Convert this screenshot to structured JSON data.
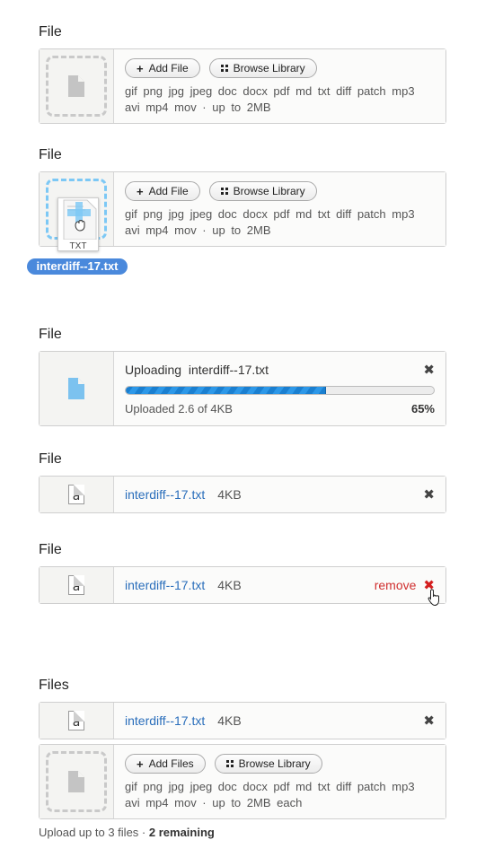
{
  "section1": {
    "label": "File",
    "add_button": "Add File",
    "browse_button": "Browse Library",
    "formats_line1": "gif png jpg jpeg doc docx pdf md txt diff patch mp3",
    "formats_line2": "avi mp4 mov · up to 2MB"
  },
  "section2": {
    "label": "File",
    "add_button": "Add File",
    "browse_button": "Browse Library",
    "formats_line1": "gif png jpg jpeg doc docx pdf md txt diff patch mp3",
    "formats_line2": "avi mp4 mov · up to 2MB",
    "drag_file_type": "TXT",
    "drag_file_name": "interdiff--17.txt"
  },
  "section3": {
    "label": "File",
    "uploading_prefix": "Uploading",
    "file_name": "interdiff--17.txt",
    "progress_percent": 65,
    "progress_label": "65%",
    "status": "Uploaded 2.6 of 4KB",
    "accent_color": "#1a7fd0"
  },
  "section4": {
    "label": "File",
    "file_name": "interdiff--17.txt",
    "file_size": "4KB"
  },
  "section5": {
    "label": "File",
    "file_name": "interdiff--17.txt",
    "file_size": "4KB",
    "remove_label": "remove"
  },
  "section6": {
    "label": "Files",
    "file_name": "interdiff--17.txt",
    "file_size": "4KB",
    "add_button": "Add Files",
    "browse_button": "Browse Library",
    "formats_line1": "gif png jpg jpeg doc docx pdf md txt diff patch mp3",
    "formats_line2": "avi mp4 mov · up to 2MB each",
    "footer_limit": "Upload up to 3 files",
    "footer_sep": "·",
    "footer_remaining": "2 remaining"
  },
  "icons": {
    "close": "✖",
    "plus": "+",
    "doc_letter": "a"
  }
}
